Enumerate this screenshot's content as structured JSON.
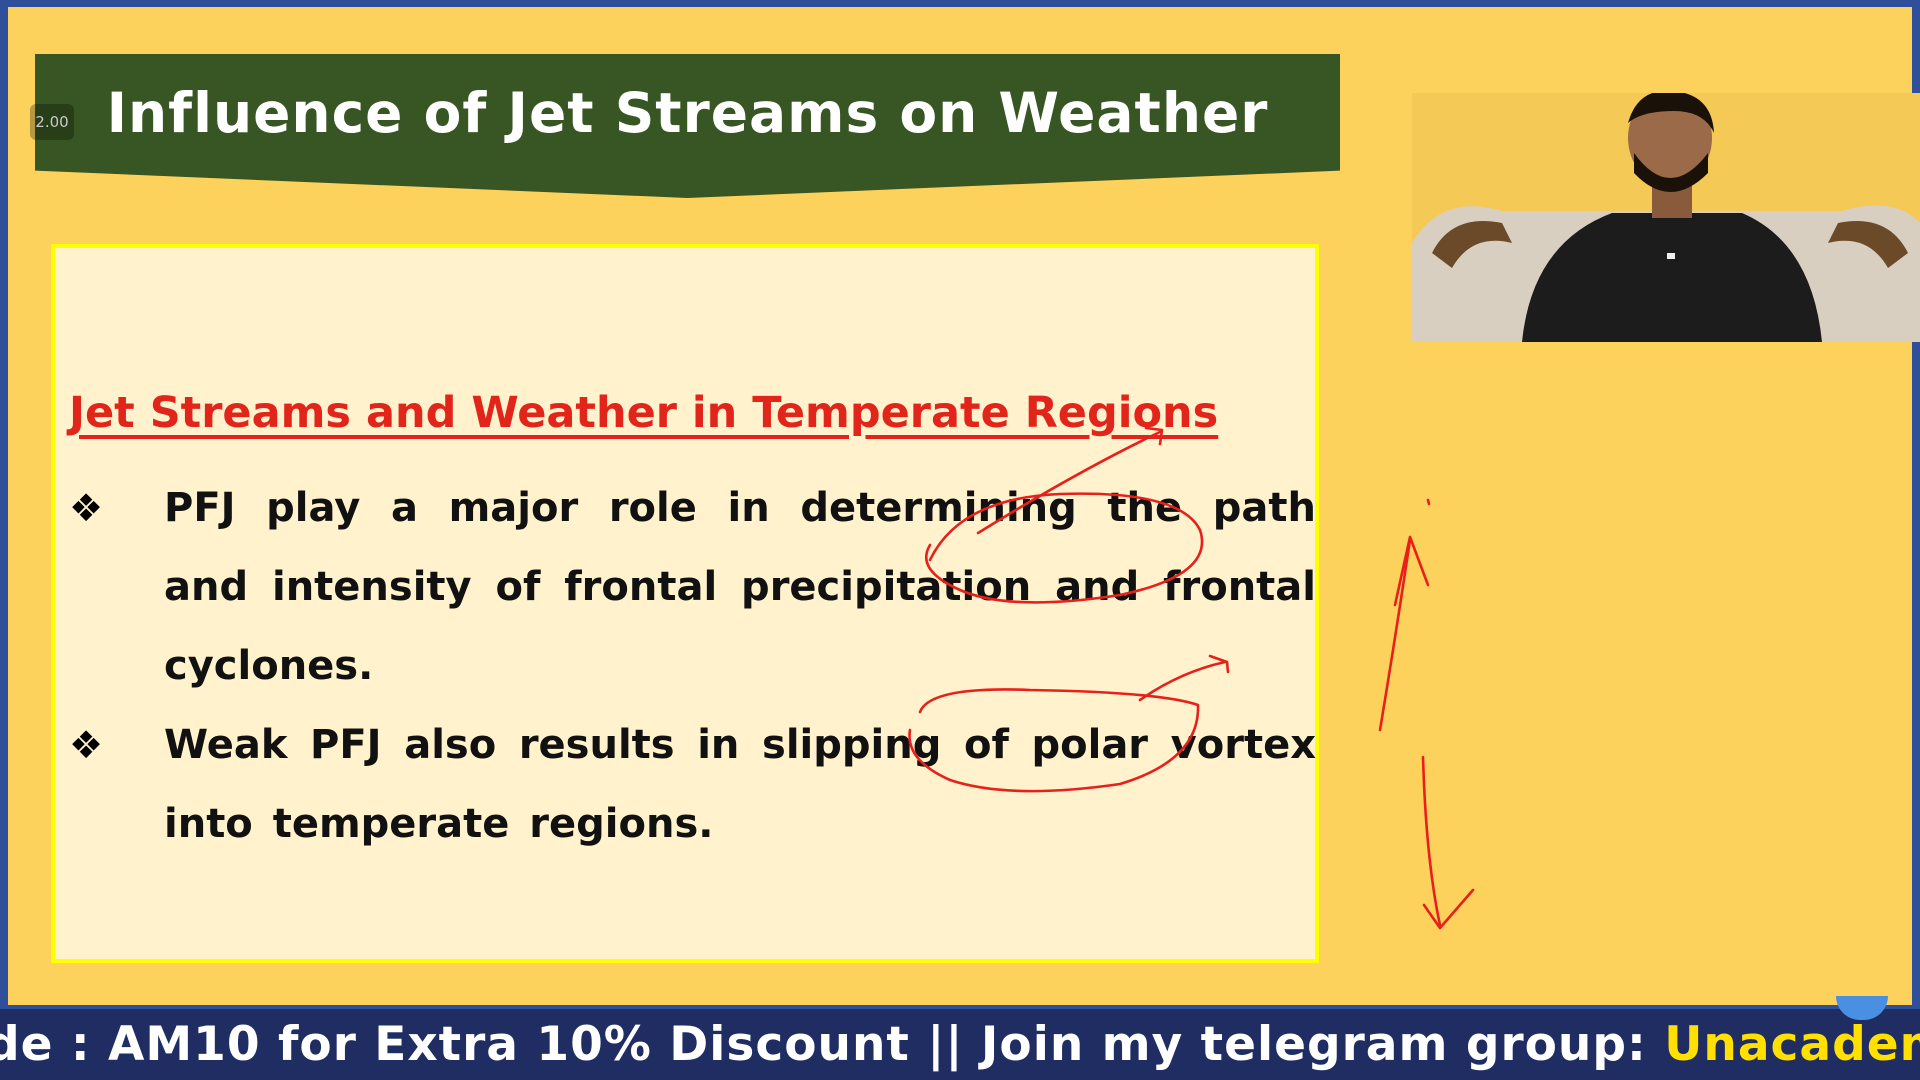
{
  "slide": {
    "title": "Influence of Jet Streams on Weather",
    "speed_badge": "2.00",
    "heading": "Jet Streams and Weather in Temperate Regions",
    "bullets": [
      {
        "marker": "❖",
        "text": "PFJ play a major role in determining the path and intensity of frontal precipitation and frontal cyclones."
      },
      {
        "marker": "❖",
        "text": "Weak PFJ also results in slipping of polar vortex into temperate regions."
      }
    ]
  },
  "ticker": {
    "part_white": "de : AM10 for Extra 10% Discount || Join my telegram group: ",
    "part_yellow": "Unacademy_Aniruddh"
  },
  "colors": {
    "slide_background": "#fdd25c",
    "title_banner": "#375623",
    "content_box": "#fff2cc",
    "content_border": "#ffff00",
    "heading": "#e1251b",
    "annotation_ink": "#e8201c",
    "ticker_background": "#1f2d63",
    "ticker_highlight": "#ffe000"
  },
  "icons": {
    "bullet": "diamond-bullet-icon",
    "annotations": [
      "hand-drawn-circle",
      "hand-drawn-arrow"
    ]
  }
}
